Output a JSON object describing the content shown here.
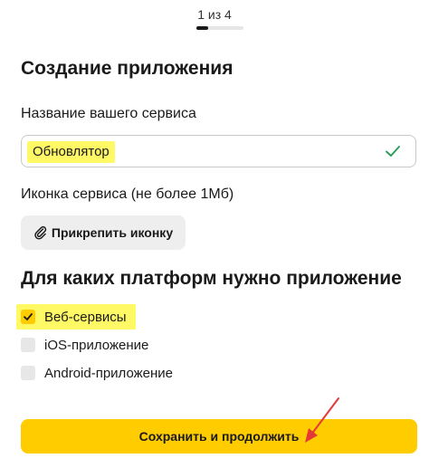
{
  "progress": {
    "step_label": "1 из 4",
    "current": 1,
    "total": 4,
    "fill_fraction": 0.25
  },
  "form": {
    "title": "Создание приложения",
    "name_label": "Название вашего сервиса",
    "name_value": "Обновлятор",
    "icon_label": "Иконка сервиса (не более 1Мб)",
    "attach_button": "Прикрепить иконку",
    "platforms_title": "Для каких платформ нужно приложение",
    "platforms": [
      {
        "label": "Веб-сервисы",
        "checked": true
      },
      {
        "label": "iOS-приложение",
        "checked": false
      },
      {
        "label": "Android-приложение",
        "checked": false
      }
    ],
    "submit_button": "Сохранить и продолжить"
  },
  "icons": {
    "valid": "checkmark-icon",
    "attach": "paperclip-icon",
    "annotation": "red-arrow-icon"
  },
  "colors": {
    "accent": "#ffcc00",
    "valid": "#2e9e5b",
    "highlight": "#fff966",
    "annotation": "#e53935"
  }
}
